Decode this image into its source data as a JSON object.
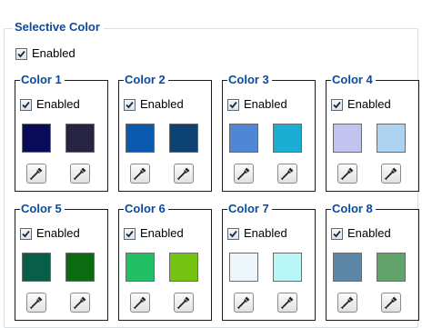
{
  "selective_color": {
    "title": "Selective Color",
    "enabled_label": "Enabled",
    "enabled": true
  },
  "colors": [
    {
      "title": "Color 1",
      "enabled_label": "Enabled",
      "enabled": true,
      "swatches": [
        "#0b0b5c",
        "#262343"
      ]
    },
    {
      "title": "Color 2",
      "enabled_label": "Enabled",
      "enabled": true,
      "swatches": [
        "#0c5aaf",
        "#0d4372"
      ]
    },
    {
      "title": "Color 3",
      "enabled_label": "Enabled",
      "enabled": true,
      "swatches": [
        "#4f87d5",
        "#1aaed4"
      ]
    },
    {
      "title": "Color 4",
      "enabled_label": "Enabled",
      "enabled": true,
      "swatches": [
        "#c3c3f0",
        "#aed3f1"
      ]
    },
    {
      "title": "Color 5",
      "enabled_label": "Enabled",
      "enabled": true,
      "swatches": [
        "#075e49",
        "#0b6b10"
      ]
    },
    {
      "title": "Color 6",
      "enabled_label": "Enabled",
      "enabled": true,
      "swatches": [
        "#21c065",
        "#74c212"
      ]
    },
    {
      "title": "Color 7",
      "enabled_label": "Enabled",
      "enabled": true,
      "swatches": [
        "#edf6fb",
        "#b9f6f8"
      ]
    },
    {
      "title": "Color 8",
      "enabled_label": "Enabled",
      "enabled": true,
      "swatches": [
        "#5b86a5",
        "#60a26a"
      ]
    }
  ],
  "icons": {
    "checkbox": "checkmark-icon",
    "picker": "eyedropper-icon"
  }
}
